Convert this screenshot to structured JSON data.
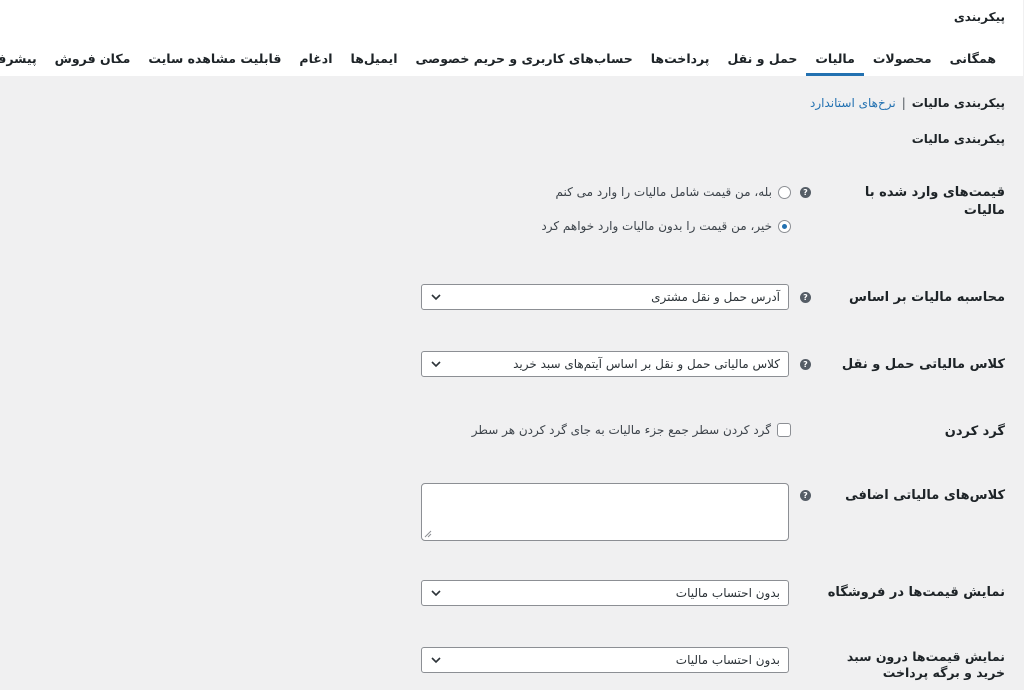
{
  "page": {
    "title": "پیکربندی"
  },
  "tabs": [
    {
      "label": "همگانی",
      "active": false
    },
    {
      "label": "محصولات",
      "active": false
    },
    {
      "label": "مالیات",
      "active": true
    },
    {
      "label": "حمل و نقل",
      "active": false
    },
    {
      "label": "پرداخت‌ها",
      "active": false
    },
    {
      "label": "حساب‌های کاربری و حریم خصوصی",
      "active": false
    },
    {
      "label": "ایمیل‌ها",
      "active": false
    },
    {
      "label": "ادغام",
      "active": false
    },
    {
      "label": "قابلیت مشاهده سایت",
      "active": false
    },
    {
      "label": "مکان فروش",
      "active": false
    },
    {
      "label": "پیشرفته",
      "active": false
    }
  ],
  "subnav": {
    "current": "پیکربندی مالیات",
    "separator": "|",
    "link": "نرخ‌های استاندارد"
  },
  "section_title": "پیکربندی مالیات",
  "fields": {
    "prices_entered": {
      "label": "قیمت‌های وارد شده با مالیات",
      "options": [
        {
          "label": "بله، من قیمت شامل مالیات را وارد می کنم",
          "checked": false
        },
        {
          "label": "خیر، من قیمت را بدون مالیات وارد خواهم کرد",
          "checked": true
        }
      ]
    },
    "calc_based_on": {
      "label": "محاسبه مالیات بر اساس",
      "value": "آدرس حمل و نقل مشتری"
    },
    "shipping_tax_class": {
      "label": "کلاس مالیاتی حمل و نقل",
      "value": "کلاس مالیاتی حمل و نقل بر اساس آیتم‌های سبد خرید"
    },
    "rounding": {
      "label": "گرد کردن",
      "checkbox_label": "گرد کردن سطر جمع جزء مالیات به جای گرد کردن هر سطر",
      "checked": false
    },
    "additional_classes": {
      "label": "کلاس‌های مالیاتی اضافی",
      "value": ""
    },
    "display_shop": {
      "label": "نمایش قیمت‌ها در فروشگاه",
      "value": "بدون احتساب مالیات"
    },
    "display_cart": {
      "label": "نمایش قیمت‌ها درون سبد خرید و برگه پرداخت",
      "value": "بدون احتساب مالیات"
    }
  },
  "help_glyph": "?",
  "colors": {
    "accent": "#2271b1",
    "background": "#f0f0f1",
    "header": "#ffffff"
  }
}
